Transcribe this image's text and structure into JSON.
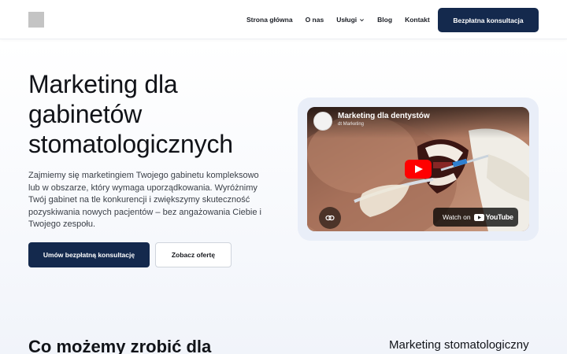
{
  "header": {
    "nav": [
      {
        "label": "Strona główna"
      },
      {
        "label": "O nas"
      },
      {
        "label": "Usługi"
      },
      {
        "label": "Blog"
      },
      {
        "label": "Kontakt"
      }
    ],
    "cta_label": "Bezpłatna konsultacja"
  },
  "hero": {
    "title": "Marketing dla gabinetów stomatologicznych",
    "description": "Zajmiemy się marketingiem Twojego gabinetu kompleksowo lub w obszarze, który wymaga uporządkowania. Wyróżnimy Twój gabinet na tle konkurencji i zwiększymy skuteczność pozyskiwania nowych pacjentów – bez angażowania Ciebie i Twojego zespołu.",
    "primary_button": "Umów bezpłatną konsultację",
    "secondary_button": "Zobacz ofertę"
  },
  "video": {
    "title": "Marketing dla dentystów",
    "channel": "dt Marketing",
    "watch_on": "Watch on",
    "youtube": "YouTube"
  },
  "section": {
    "title": "Co możemy zrobić dla",
    "right_text": "Marketing stomatologiczny"
  },
  "colors": {
    "primary": "#14294d",
    "youtube_red": "#ff0000"
  }
}
